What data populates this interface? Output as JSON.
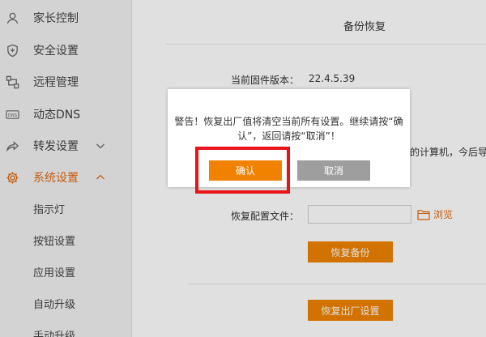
{
  "sidebar": {
    "items": [
      {
        "label": "家长控制",
        "icon": "user-icon"
      },
      {
        "label": "安全设置",
        "icon": "shield-icon"
      },
      {
        "label": "远程管理",
        "icon": "remote-icon"
      },
      {
        "label": "动态DNS",
        "icon": "dns-icon"
      },
      {
        "label": "转发设置",
        "icon": "forward-icon"
      },
      {
        "label": "系统设置",
        "icon": "gear-icon"
      }
    ],
    "sub_items": [
      "指示灯",
      "按钮设置",
      "应用设置",
      "自动升级",
      "手动升级"
    ]
  },
  "main": {
    "section_title": "备份恢复",
    "firmware_label": "当前固件版本：",
    "firmware_value": "22.4.5.39",
    "partial_text": "的计算机，今后导",
    "restore_label": "恢复配置文件：",
    "browse_label": "浏览",
    "restore_backup_button": "恢复备份",
    "factory_reset_button": "恢复出厂设置"
  },
  "dialog": {
    "message": "警告！恢复出厂值将清空当前所有设置。继续请按“确认”，返回请按“取消”！",
    "confirm_label": "确认",
    "cancel_label": "取消"
  },
  "colors": {
    "accent": "#f08200",
    "active_text": "#e06a12",
    "cancel": "#9e9e9e",
    "highlight": "#e8141a",
    "sidebar_bg": "#f1f1f1"
  }
}
